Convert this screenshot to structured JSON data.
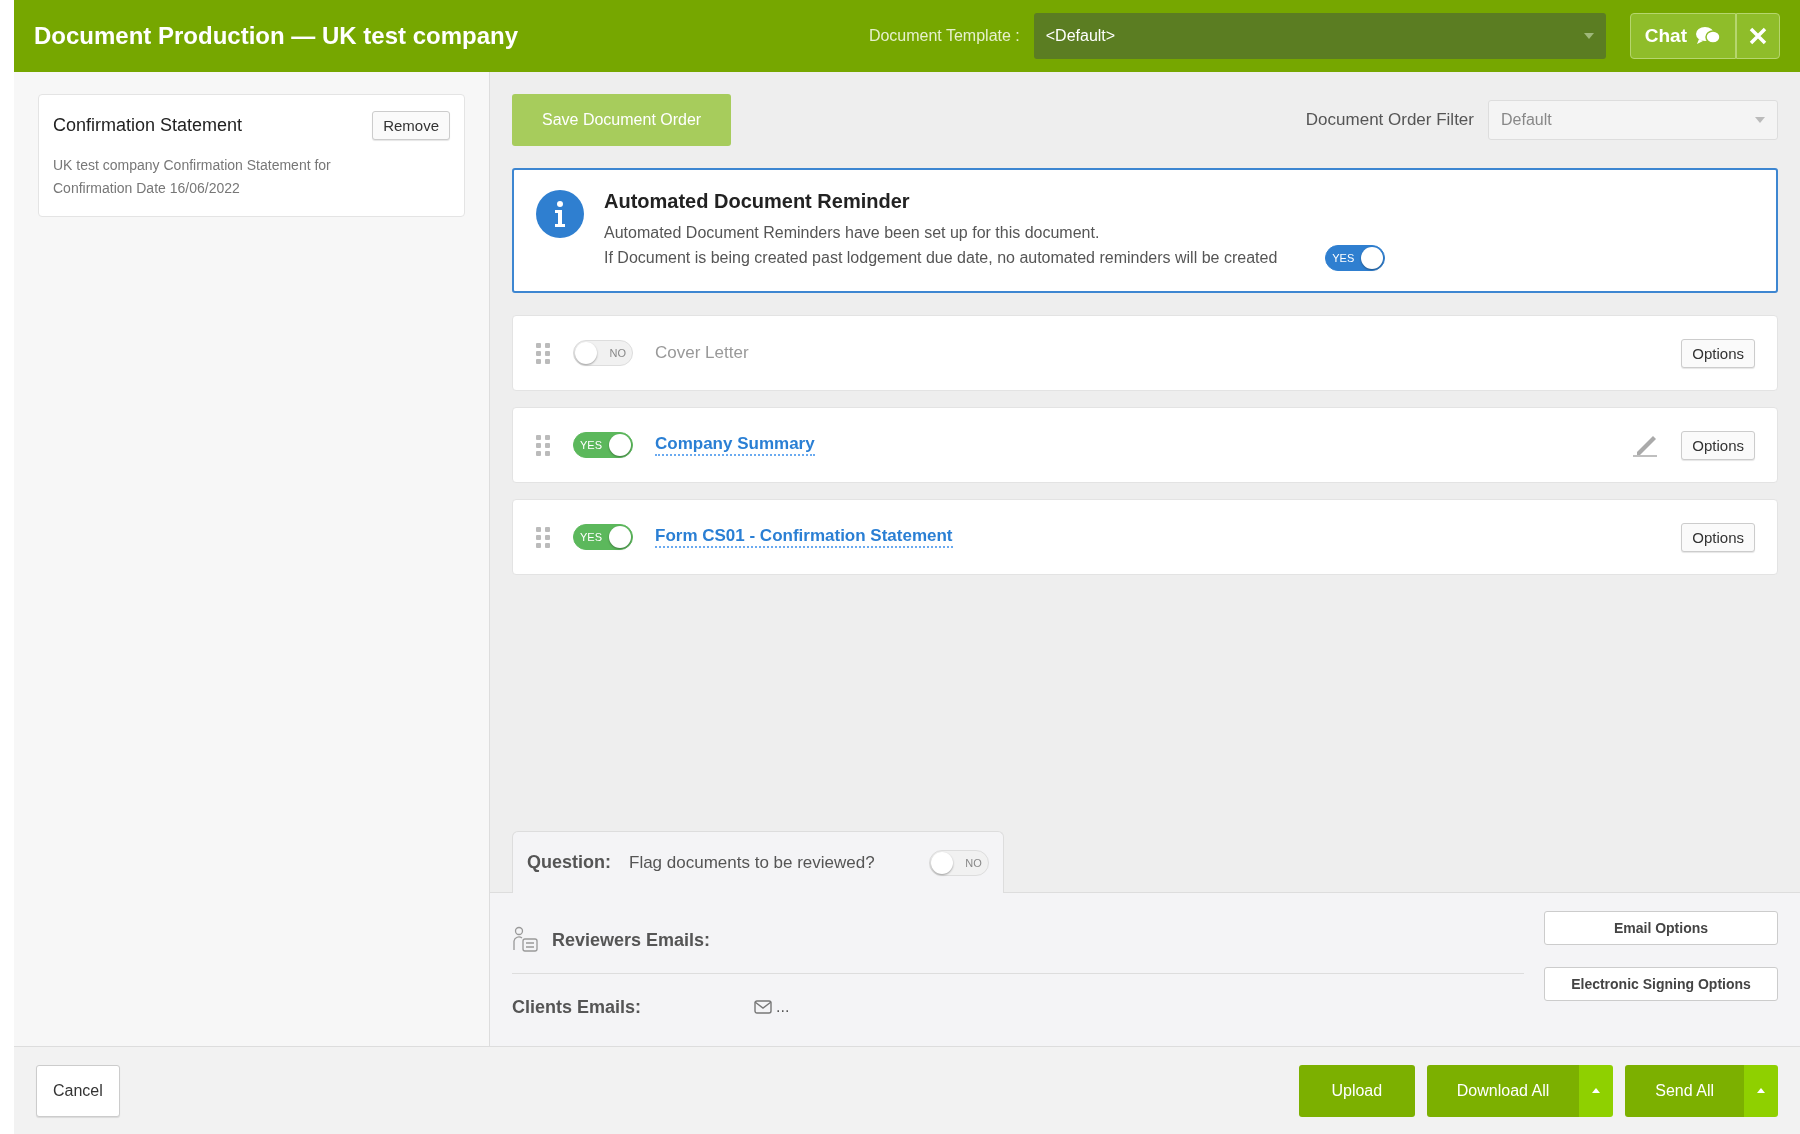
{
  "header": {
    "title": "Document Production — UK test company",
    "template_label": "Document Template :",
    "template_value": "<Default>",
    "chat": "Chat"
  },
  "sidebar": {
    "cards": [
      {
        "title": "Confirmation Statement",
        "button": "Remove",
        "description": "UK test company Confirmation Statement for Confirmation Date 16/06/2022"
      }
    ]
  },
  "toolbar": {
    "save": "Save Document Order",
    "filter_label": "Document Order Filter",
    "filter_value": "Default"
  },
  "reminder": {
    "title": "Automated Document Reminder",
    "lines": [
      "Automated Document Reminders have been set up for this document.",
      "If Document is being created past lodgement due date, no automated reminders will be created"
    ],
    "toggle": {
      "on": true,
      "label": "YES"
    }
  },
  "documents": [
    {
      "title": "Cover Letter",
      "toggle": {
        "on": false,
        "label": "NO"
      },
      "signature_icon": false,
      "button": "Options"
    },
    {
      "title": "Company Summary",
      "toggle": {
        "on": true,
        "label": "YES"
      },
      "signature_icon": true,
      "button": "Options"
    },
    {
      "title": "Form CS01 - Confirmation Statement",
      "toggle": {
        "on": true,
        "label": "YES"
      },
      "signature_icon": false,
      "button": "Options"
    }
  ],
  "question": {
    "label": "Question:",
    "text": "Flag documents to be reviewed?",
    "toggle": {
      "on": false,
      "label": "NO"
    }
  },
  "emails": {
    "reviewers": "Reviewers Emails:",
    "clients": "Clients Emails:",
    "clients_value": "...",
    "buttons": [
      "Email Options",
      "Electronic Signing Options"
    ]
  },
  "footer": {
    "cancel": "Cancel",
    "actions": [
      {
        "label": "Upload",
        "dropdown": false
      },
      {
        "label": "Download All",
        "dropdown": true
      },
      {
        "label": "Send All",
        "dropdown": true
      }
    ]
  }
}
